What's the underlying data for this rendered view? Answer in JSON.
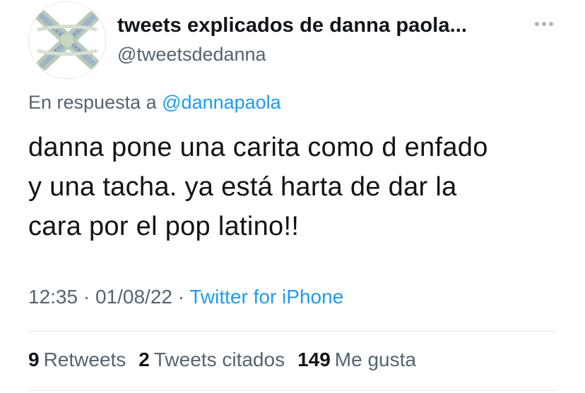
{
  "author": {
    "display_name": "tweets explicados de danna paola...",
    "handle": "@tweetsdedanna",
    "avatar_icon": "crossed-x-photo-avatar"
  },
  "reply": {
    "prefix": "En respuesta a",
    "mention": "@dannapaola"
  },
  "tweet": {
    "lines": [
      "danna pone una carita como d enfado",
      "y una tacha. ya está harta de dar la",
      "cara por el pop latino!!"
    ]
  },
  "meta": {
    "time": "12:35",
    "separator1": "·",
    "date": "01/08/22",
    "separator2": "·",
    "source": "Twitter for iPhone"
  },
  "stats": {
    "retweets": {
      "count": "9",
      "label": "Retweets"
    },
    "quotes": {
      "count": "2",
      "label": "Tweets citados"
    },
    "likes": {
      "count": "149",
      "label": "Me gusta"
    }
  },
  "colors": {
    "link": "#1d9bf0",
    "secondary_text": "#536471",
    "primary_text": "#0f1419"
  }
}
